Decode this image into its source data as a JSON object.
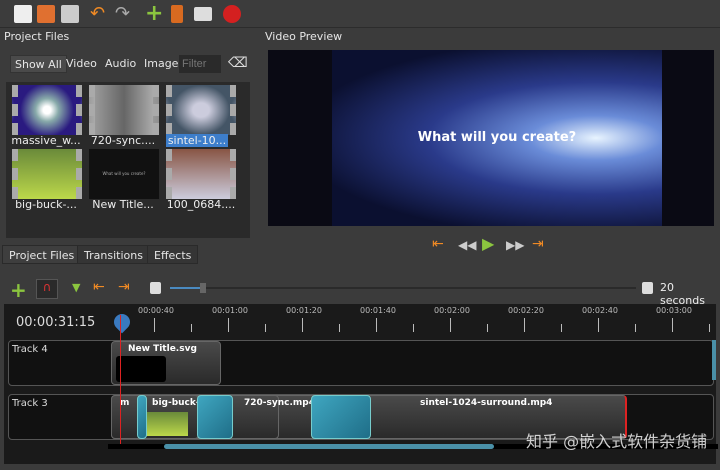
{
  "toolbar": {
    "icons": [
      "new-project-icon",
      "open-project-icon",
      "save-project-icon",
      "undo-icon",
      "redo-icon",
      "import-files-icon",
      "choose-profile-icon",
      "fullscreen-icon",
      "export-video-icon"
    ]
  },
  "project_files": {
    "title": "Project Files",
    "filters": [
      "Show All",
      "Video",
      "Audio",
      "Image"
    ],
    "filter_placeholder": "Filter",
    "files": [
      "massive_w...",
      "720-sync....",
      "sintel-10...",
      "big-buck-...",
      "New Title...",
      "100_0684...."
    ],
    "selected": "sintel-10...",
    "title_text": "What will you create?"
  },
  "preview": {
    "title": "Video Preview",
    "overlay_text": "What will you create?"
  },
  "tabs": [
    "Project Files",
    "Transitions",
    "Effects"
  ],
  "timeline": {
    "zoom_label": "20 seconds",
    "current_time": "00:00:31:15",
    "ruler": [
      "00:00:40",
      "00:01:00",
      "00:01:20",
      "00:01:40",
      "00:02:00",
      "00:02:20",
      "00:02:40",
      "00:03:00"
    ],
    "tracks": [
      {
        "name": "Track 4",
        "clips": [
          "New Title.svg"
        ]
      },
      {
        "name": "Track 3",
        "clips": [
          "m",
          "big-buck-",
          "720-sync.mp4",
          "sintel-1024-surround.mp4"
        ]
      }
    ]
  },
  "watermark": "知乎 @嵌入式软件杂货铺",
  "colors": {
    "accent": "#f08a24",
    "play": "#8bc53f",
    "selection": "#3d7ecb"
  }
}
